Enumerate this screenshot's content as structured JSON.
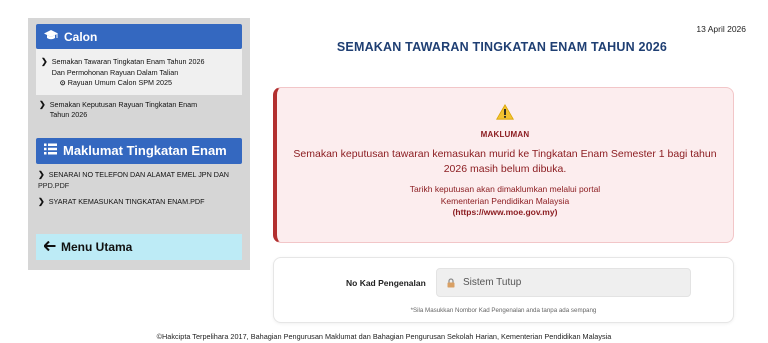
{
  "sidebar": {
    "calon": {
      "icon": "graduation-cap-icon",
      "title": "Calon",
      "items": [
        {
          "label": "Semakan Tawaran Tingkatan Enam Tahun 2026",
          "label2": "Dan Permohonan Rayuan Dalam Talian",
          "sub": "Rayuan Umum Calon SPM 2025",
          "sub_icon": "⊙"
        },
        {
          "label": "Semakan Keputusan Rayuan Tingkatan Enam",
          "label2": "Tahun 2026"
        }
      ]
    },
    "maklumat": {
      "icon": "list-icon",
      "title": "Maklumat Tingkatan Enam",
      "items": [
        {
          "label": "SENARAI NO TELEFON DAN ALAMAT EMEL JPN DAN",
          "label2": "PPD.PDF"
        },
        {
          "label": "SYARAT KEMASUKAN TINGKATAN ENAM.PDF"
        }
      ]
    },
    "menu_utama": {
      "icon": "arrow-left-icon",
      "label": "Menu Utama"
    },
    "colors": {
      "panel": "#d6d6d6",
      "header": "#3468c0",
      "menu": "#bdebf6"
    }
  },
  "date": "13 April 2026",
  "page_title": "SEMAKAN TAWARAN TINGKATAN ENAM TAHUN 2026",
  "alert": {
    "icon": "warning-icon",
    "heading": "MAKLUMAN",
    "message_line1": "Semakan keputusan tawaran kemasukan murid ke Tingkatan Enam Semester 1 bagi tahun",
    "message_line2": "2026 masih belum dibuka.",
    "note_line1": "Tarikh keputusan akan dimaklumkan melalui portal",
    "note_line2": "Kementerian Pendidikan Malaysia",
    "note_url": "(https://www.moe.gov.my)",
    "colors": {
      "background": "#fcedee",
      "border": "#b22f2f",
      "text": "#8c1e22"
    }
  },
  "form": {
    "ic_label": "No Kad Pengenalan",
    "ic_value": "Sistem Tutup",
    "ic_icon": "lock-icon",
    "hint": "*Sila Masukkan Nombor Kad Pengenalan anda tanpa ada sempang"
  },
  "footer": "©Hakcipta Terpelihara 2017, Bahagian Pengurusan Maklumat dan Bahagian Pengurusan Sekolah Harian, Kementerian Pendidikan Malaysia"
}
